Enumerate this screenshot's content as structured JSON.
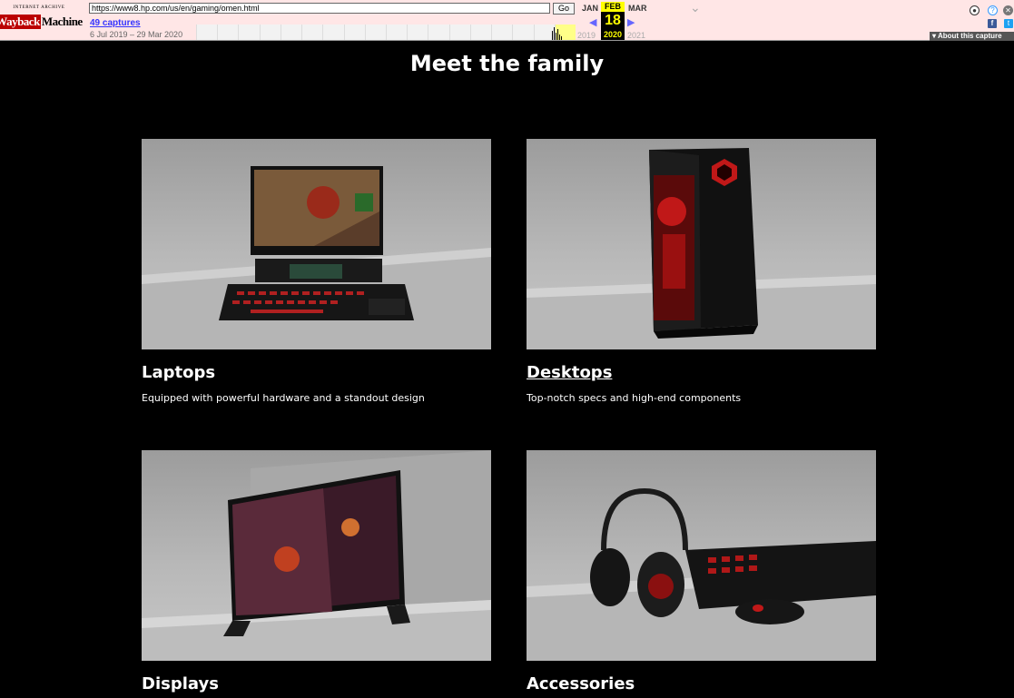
{
  "wayback": {
    "logo_top": "INTERNET ARCHIVE",
    "logo_main_a": "Wayback",
    "logo_main_b": "Machine",
    "url": "https://www8.hp.com/us/en/gaming/omen.html",
    "go_label": "Go",
    "captures": "49 captures",
    "range": "6 Jul 2019 – 29 Mar 2020",
    "prev_month": "JAN",
    "cur_month": "FEB",
    "next_month": "MAR",
    "day": "18",
    "prev_year": "2019",
    "cur_year": "2020",
    "next_year": "2021",
    "about": "About this capture"
  },
  "page": {
    "title": "Meet the family"
  },
  "cards": [
    {
      "title": "Laptops",
      "desc": "Equipped with powerful hardware and a standout design"
    },
    {
      "title": "Desktops",
      "desc": "Top-notch specs and high-end components"
    },
    {
      "title": "Displays",
      "desc": ""
    },
    {
      "title": "Accessories",
      "desc": ""
    }
  ],
  "colors": {
    "background": "#000000",
    "accent_red": "#d01010",
    "toolbar_bg": "#ffe6e6"
  }
}
